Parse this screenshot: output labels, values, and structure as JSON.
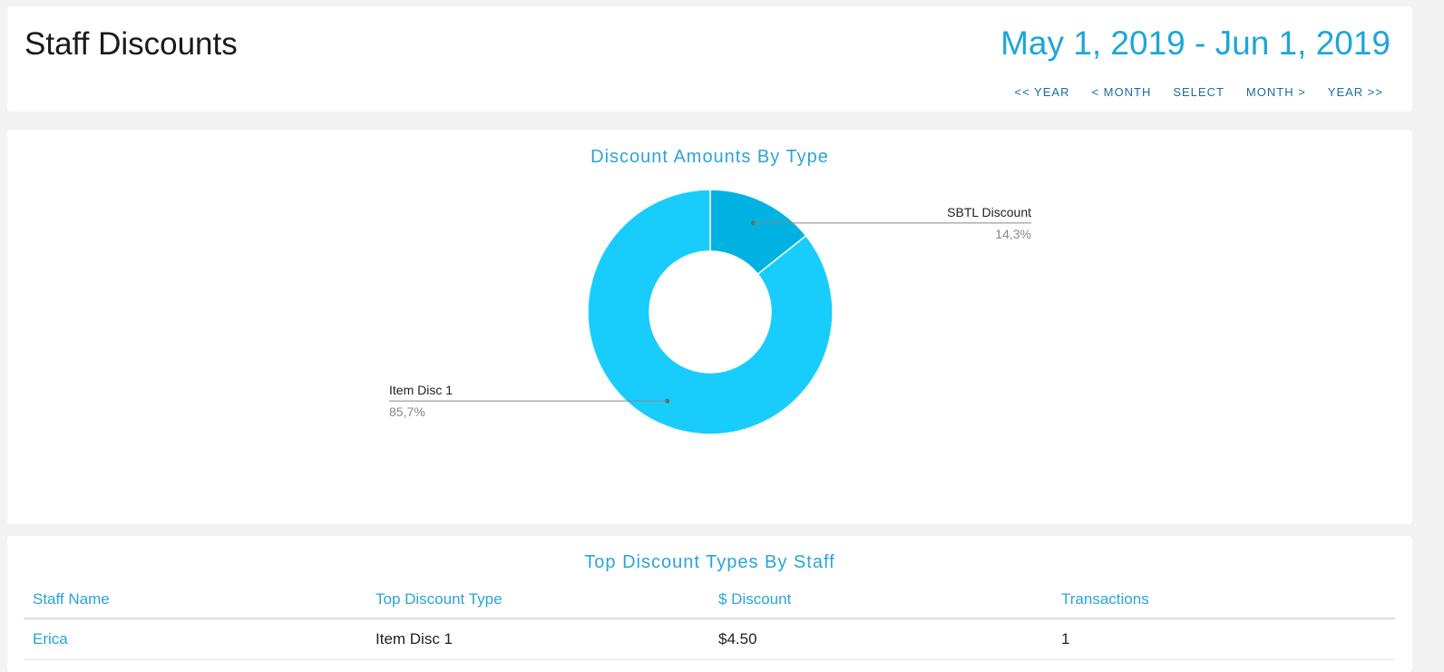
{
  "header": {
    "title": "Staff Discounts",
    "date_range": "May 1, 2019 - Jun 1, 2019",
    "nav": [
      "<< YEAR",
      "< MONTH",
      "SELECT",
      "MONTH >",
      "YEAR >>"
    ]
  },
  "chart_section": {
    "title": "Discount Amounts By Type"
  },
  "chart_data": {
    "type": "pie",
    "title": "Discount Amounts By Type",
    "donut": true,
    "slices": [
      {
        "label": "SBTL Discount",
        "percent_label": "14,3%",
        "value": 14.3,
        "color": "#00b2e2"
      },
      {
        "label": "Item Disc 1",
        "percent_label": "85,7%",
        "value": 85.7,
        "color": "#18cdfc"
      }
    ]
  },
  "table_section": {
    "title": "Top Discount Types By Staff",
    "columns": [
      "Staff Name",
      "Top Discount Type",
      "$ Discount",
      "Transactions"
    ],
    "rows": [
      [
        "Erica",
        "Item Disc 1",
        "$4.50",
        "1"
      ]
    ]
  }
}
